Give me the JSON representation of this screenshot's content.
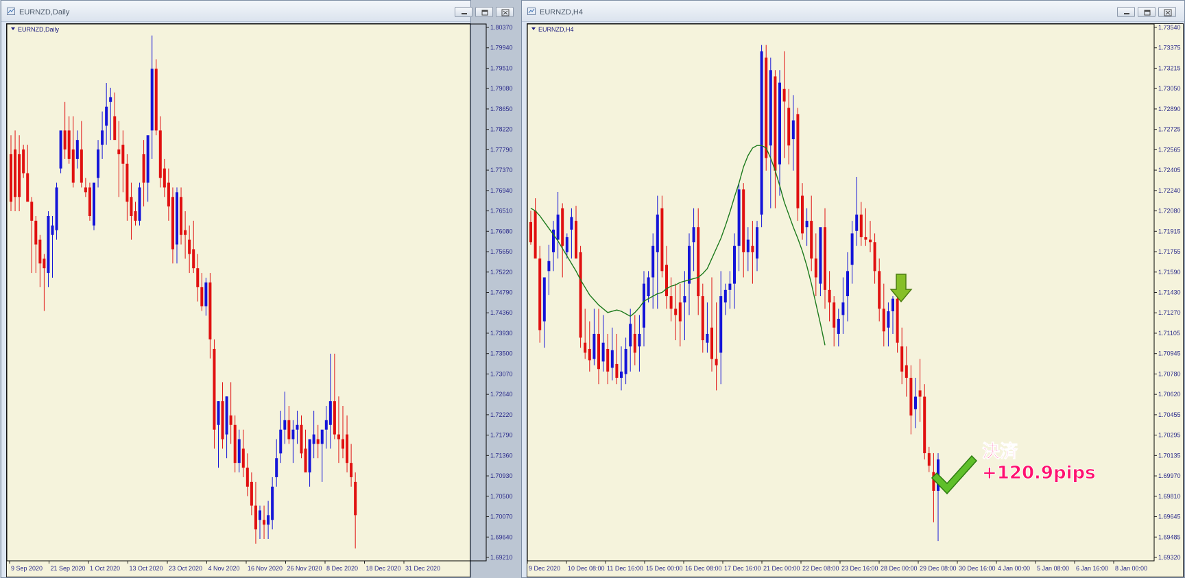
{
  "windows": [
    {
      "title": "EURNZD,Daily",
      "label": "EURNZD,Daily",
      "yTicks": [
        "1.80370",
        "1.79940",
        "1.79510",
        "1.79080",
        "1.78650",
        "1.78220",
        "1.77790",
        "1.77370",
        "1.76940",
        "1.76510",
        "1.76080",
        "1.75650",
        "1.75220",
        "1.74790",
        "1.74360",
        "1.73930",
        "1.73500",
        "1.73070",
        "1.72640",
        "1.72220",
        "1.71790",
        "1.71360",
        "1.70930",
        "1.70500",
        "1.70070",
        "1.69640",
        "1.69210"
      ],
      "xTicks": [
        "9 Sep 2020",
        "21 Sep 2020",
        "1 Oct 2020",
        "13 Oct 2020",
        "23 Oct 2020",
        "4 Nov 2020",
        "16 Nov 2020",
        "26 Nov 2020",
        "8 Dec 2020",
        "18 Dec 2020",
        "31 Dec 2020"
      ]
    },
    {
      "title": "EURNZD,H4",
      "label": "EURNZD,H4",
      "yTicks": [
        "1.73540",
        "1.73375",
        "1.73215",
        "1.73050",
        "1.72890",
        "1.72725",
        "1.72565",
        "1.72405",
        "1.72240",
        "1.72080",
        "1.71915",
        "1.71755",
        "1.71590",
        "1.71430",
        "1.71270",
        "1.71105",
        "1.70945",
        "1.70780",
        "1.70620",
        "1.70455",
        "1.70295",
        "1.70135",
        "1.69970",
        "1.69810",
        "1.69645",
        "1.69485",
        "1.69320"
      ],
      "xTicks": [
        "9 Dec 2020",
        "10 Dec 08:00",
        "11 Dec 16:00",
        "15 Dec 00:00",
        "16 Dec 08:00",
        "17 Dec 16:00",
        "21 Dec 00:00",
        "22 Dec 08:00",
        "23 Dec 16:00",
        "28 Dec 00:00",
        "29 Dec 08:00",
        "30 Dec 16:00",
        "4 Jan 00:00",
        "5 Jan 08:00",
        "6 Jan 16:00",
        "8 Jan 00:00"
      ]
    }
  ],
  "annotation": {
    "line1": "決済",
    "line2": "+120.9pips"
  },
  "colors": {
    "plot_bg": "#f5f3dc",
    "bull": "#1414d8",
    "bear": "#e01010",
    "ma": "#1c7a1c",
    "axis_text": "#2a2a8a",
    "annotation": "#ff1070"
  },
  "chart_data": [
    {
      "type": "candlestick",
      "symbol": "EURNZD",
      "timeframe": "Daily",
      "ylim": [
        1.6921,
        1.8037
      ],
      "candles": [
        [
          1.777,
          1.781,
          1.765,
          1.767
        ],
        [
          1.778,
          1.782,
          1.765,
          1.768
        ],
        [
          1.777,
          1.781,
          1.765,
          1.768
        ],
        [
          1.778,
          1.779,
          1.772,
          1.773
        ],
        [
          1.773,
          1.779,
          1.772,
          1.767
        ],
        [
          1.767,
          1.768,
          1.752,
          1.763
        ],
        [
          1.763,
          1.764,
          1.752,
          1.758
        ],
        [
          1.759,
          1.76,
          1.749,
          1.754
        ],
        [
          1.755,
          1.756,
          1.744,
          1.753
        ],
        [
          1.752,
          1.765,
          1.749,
          1.764
        ],
        [
          1.76,
          1.764,
          1.751,
          1.762
        ],
        [
          1.761,
          1.771,
          1.759,
          1.77
        ],
        [
          1.774,
          1.781,
          1.773,
          1.782
        ],
        [
          1.782,
          1.788,
          1.776,
          1.778
        ],
        [
          1.782,
          1.785,
          1.775,
          1.776
        ],
        [
          1.778,
          1.785,
          1.77,
          1.771
        ],
        [
          1.776,
          1.782,
          1.774,
          1.78
        ],
        [
          1.778,
          1.784,
          1.77,
          1.771
        ],
        [
          1.77,
          1.772,
          1.768,
          1.769
        ],
        [
          1.77,
          1.771,
          1.763,
          1.764
        ],
        [
          1.762,
          1.769,
          1.761,
          1.771
        ],
        [
          1.772,
          1.78,
          1.77,
          1.778
        ],
        [
          1.779,
          1.786,
          1.776,
          1.782
        ],
        [
          1.783,
          1.792,
          1.779,
          1.787
        ],
        [
          1.788,
          1.791,
          1.78,
          1.789
        ],
        [
          1.785,
          1.79,
          1.781,
          1.78
        ],
        [
          1.778,
          1.784,
          1.768,
          1.777
        ],
        [
          1.779,
          1.782,
          1.769,
          1.775
        ],
        [
          1.775,
          1.777,
          1.763,
          1.767
        ],
        [
          1.768,
          1.771,
          1.759,
          1.764
        ],
        [
          1.765,
          1.767,
          1.762,
          1.763
        ],
        [
          1.763,
          1.771,
          1.762,
          1.77
        ],
        [
          1.777,
          1.78,
          1.766,
          1.771
        ],
        [
          1.771,
          1.775,
          1.767,
          1.781
        ],
        [
          1.782,
          1.802,
          1.776,
          1.795
        ],
        [
          1.795,
          1.797,
          1.781,
          1.782
        ],
        [
          1.782,
          1.785,
          1.77,
          1.772
        ],
        [
          1.774,
          1.776,
          1.768,
          1.77
        ],
        [
          1.771,
          1.774,
          1.763,
          1.766
        ],
        [
          1.768,
          1.77,
          1.754,
          1.757
        ],
        [
          1.758,
          1.77,
          1.754,
          1.769
        ],
        [
          1.768,
          1.77,
          1.758,
          1.76
        ],
        [
          1.761,
          1.765,
          1.755,
          1.76
        ],
        [
          1.759,
          1.762,
          1.752,
          1.756
        ],
        [
          1.757,
          1.763,
          1.752,
          1.753
        ],
        [
          1.753,
          1.756,
          1.746,
          1.749
        ],
        [
          1.749,
          1.752,
          1.744,
          1.745
        ],
        [
          1.745,
          1.751,
          1.743,
          1.75
        ],
        [
          1.75,
          1.752,
          1.734,
          1.738
        ],
        [
          1.736,
          1.738,
          1.715,
          1.719
        ],
        [
          1.72,
          1.725,
          1.711,
          1.725
        ],
        [
          1.725,
          1.729,
          1.715,
          1.717
        ],
        [
          1.718,
          1.726,
          1.713,
          1.726
        ],
        [
          1.722,
          1.729,
          1.716,
          1.72
        ],
        [
          1.72,
          1.722,
          1.71,
          1.712
        ],
        [
          1.712,
          1.719,
          1.71,
          1.717
        ],
        [
          1.715,
          1.719,
          1.709,
          1.711
        ],
        [
          1.711,
          1.714,
          1.705,
          1.707
        ],
        [
          1.708,
          1.71,
          1.701,
          1.703
        ],
        [
          1.703,
          1.708,
          1.695,
          1.698
        ],
        [
          1.7,
          1.703,
          1.696,
          1.702
        ],
        [
          1.7,
          1.703,
          1.696,
          1.699
        ],
        [
          1.699,
          1.704,
          1.696,
          1.701
        ],
        [
          1.7,
          1.709,
          1.698,
          1.707
        ],
        [
          1.709,
          1.717,
          1.707,
          1.713
        ],
        [
          1.714,
          1.723,
          1.712,
          1.719
        ],
        [
          1.719,
          1.727,
          1.716,
          1.721
        ],
        [
          1.721,
          1.724,
          1.716,
          1.717
        ],
        [
          1.717,
          1.721,
          1.712,
          1.719
        ],
        [
          1.719,
          1.723,
          1.716,
          1.72
        ],
        [
          1.72,
          1.722,
          1.713,
          1.714
        ],
        [
          1.715,
          1.719,
          1.71,
          1.71
        ],
        [
          1.71,
          1.717,
          1.707,
          1.717
        ],
        [
          1.716,
          1.723,
          1.713,
          1.718
        ],
        [
          1.717,
          1.72,
          1.713,
          1.716
        ],
        [
          1.716,
          1.719,
          1.708,
          1.719
        ],
        [
          1.719,
          1.724,
          1.715,
          1.721
        ],
        [
          1.72,
          1.735,
          1.715,
          1.725
        ],
        [
          1.725,
          1.735,
          1.717,
          1.718
        ],
        [
          1.718,
          1.726,
          1.712,
          1.717
        ],
        [
          1.717,
          1.724,
          1.713,
          1.715
        ],
        [
          1.718,
          1.722,
          1.71,
          1.712
        ],
        [
          1.712,
          1.716,
          1.707,
          1.709
        ],
        [
          1.708,
          1.71,
          1.694,
          1.701
        ]
      ]
    },
    {
      "type": "candlestick",
      "symbol": "EURNZD",
      "timeframe": "H4",
      "ylim": [
        1.6932,
        1.7354
      ],
      "candles": [
        [
          1.7199,
          1.7208,
          1.7181,
          1.7183
        ],
        [
          1.7208,
          1.7218,
          1.718,
          1.717
        ],
        [
          1.717,
          1.718,
          1.7103,
          1.7113
        ],
        [
          1.712,
          1.7138,
          1.7099,
          1.7155
        ],
        [
          1.716,
          1.7181,
          1.7141,
          1.7168
        ],
        [
          1.7175,
          1.72,
          1.716,
          1.7193
        ],
        [
          1.7185,
          1.7223,
          1.717,
          1.7205
        ],
        [
          1.721,
          1.7214,
          1.7155,
          1.718
        ],
        [
          1.7175,
          1.719,
          1.717,
          1.7187
        ],
        [
          1.7193,
          1.721,
          1.717,
          1.7203
        ],
        [
          1.72,
          1.7212,
          1.719,
          1.717
        ],
        [
          1.7175,
          1.718,
          1.7099,
          1.7107
        ],
        [
          1.7103,
          1.713,
          1.709,
          1.7095
        ],
        [
          1.7098,
          1.712,
          1.708,
          1.7089
        ],
        [
          1.709,
          1.713,
          1.7085,
          1.711
        ],
        [
          1.711,
          1.713,
          1.707,
          1.7082
        ],
        [
          1.7088,
          1.7125,
          1.708,
          1.7103
        ],
        [
          1.7098,
          1.711,
          1.707,
          1.708
        ],
        [
          1.7083,
          1.7115,
          1.7073,
          1.7097
        ],
        [
          1.7086,
          1.711,
          1.707,
          1.7075
        ],
        [
          1.7075,
          1.71,
          1.7065,
          1.708
        ],
        [
          1.7078,
          1.7107,
          1.707,
          1.7098
        ],
        [
          1.71,
          1.713,
          1.708,
          1.7118
        ],
        [
          1.711,
          1.7125,
          1.7085,
          1.7095
        ],
        [
          1.71,
          1.7125,
          1.708,
          1.711
        ],
        [
          1.7115,
          1.716,
          1.71,
          1.715
        ],
        [
          1.714,
          1.716,
          1.7135,
          1.7155
        ],
        [
          1.7155,
          1.719,
          1.713,
          1.718
        ],
        [
          1.7175,
          1.722,
          1.713,
          1.7205
        ],
        [
          1.721,
          1.722,
          1.7155,
          1.716
        ],
        [
          1.7165,
          1.718,
          1.713,
          1.714
        ],
        [
          1.714,
          1.7155,
          1.712,
          1.713
        ],
        [
          1.713,
          1.715,
          1.7105,
          1.7125
        ],
        [
          1.7135,
          1.715,
          1.71,
          1.712
        ],
        [
          1.7135,
          1.716,
          1.7105,
          1.714
        ],
        [
          1.715,
          1.719,
          1.7125,
          1.718
        ],
        [
          1.7183,
          1.721,
          1.716,
          1.7195
        ],
        [
          1.7195,
          1.721,
          1.7125,
          1.714
        ],
        [
          1.714,
          1.715,
          1.7095,
          1.7105
        ],
        [
          1.7103,
          1.7135,
          1.7095,
          1.711
        ],
        [
          1.7115,
          1.7155,
          1.708,
          1.709
        ],
        [
          1.709,
          1.7135,
          1.7065,
          1.7085
        ],
        [
          1.7095,
          1.716,
          1.707,
          1.714
        ],
        [
          1.7135,
          1.715,
          1.7125,
          1.7145
        ],
        [
          1.7145,
          1.716,
          1.713,
          1.715
        ],
        [
          1.715,
          1.719,
          1.713,
          1.718
        ],
        [
          1.718,
          1.723,
          1.716,
          1.7225
        ],
        [
          1.7225,
          1.723,
          1.7155,
          1.7175
        ],
        [
          1.7175,
          1.7195,
          1.716,
          1.7185
        ],
        [
          1.718,
          1.72,
          1.715,
          1.7175
        ],
        [
          1.717,
          1.72,
          1.716,
          1.7195
        ],
        [
          1.7205,
          1.734,
          1.7195,
          1.7335
        ],
        [
          1.733,
          1.734,
          1.724,
          1.725
        ],
        [
          1.726,
          1.733,
          1.721,
          1.732
        ],
        [
          1.7315,
          1.732,
          1.721,
          1.724
        ],
        [
          1.7245,
          1.732,
          1.722,
          1.731
        ],
        [
          1.7305,
          1.7335,
          1.725,
          1.7295
        ],
        [
          1.729,
          1.7305,
          1.7245,
          1.726
        ],
        [
          1.7265,
          1.73,
          1.724,
          1.728
        ],
        [
          1.7285,
          1.729,
          1.72,
          1.721
        ],
        [
          1.722,
          1.723,
          1.7185,
          1.719
        ],
        [
          1.7195,
          1.721,
          1.718,
          1.72
        ],
        [
          1.72,
          1.722,
          1.716,
          1.717
        ],
        [
          1.717,
          1.719,
          1.714,
          1.7155
        ],
        [
          1.715,
          1.718,
          1.714,
          1.7195
        ],
        [
          1.7195,
          1.721,
          1.713,
          1.7145
        ],
        [
          1.7145,
          1.716,
          1.712,
          1.7135
        ],
        [
          1.7135,
          1.714,
          1.71,
          1.7115
        ],
        [
          1.711,
          1.713,
          1.71,
          1.7122
        ],
        [
          1.7125,
          1.7155,
          1.711,
          1.7135
        ],
        [
          1.714,
          1.7175,
          1.712,
          1.716
        ],
        [
          1.7165,
          1.72,
          1.715,
          1.719
        ],
        [
          1.7192,
          1.7235,
          1.718,
          1.7205
        ],
        [
          1.7205,
          1.7215,
          1.718,
          1.7187
        ],
        [
          1.7187,
          1.721,
          1.718,
          1.7185
        ],
        [
          1.7185,
          1.72,
          1.7175,
          1.7183
        ],
        [
          1.7183,
          1.719,
          1.715,
          1.716
        ],
        [
          1.716,
          1.717,
          1.712,
          1.713
        ],
        [
          1.713,
          1.715,
          1.71,
          1.7112
        ],
        [
          1.7115,
          1.7135,
          1.71,
          1.7128
        ],
        [
          1.7128,
          1.714,
          1.711,
          1.7138
        ],
        [
          1.7138,
          1.7145,
          1.7095,
          1.7103
        ],
        [
          1.71,
          1.7115,
          1.707,
          1.708
        ],
        [
          1.7085,
          1.71,
          1.706,
          1.7075
        ],
        [
          1.7075,
          1.7085,
          1.703,
          1.7045
        ],
        [
          1.705,
          1.7075,
          1.7035,
          1.706
        ],
        [
          1.7065,
          1.709,
          1.704,
          1.706
        ],
        [
          1.706,
          1.707,
          1.701,
          1.7015
        ],
        [
          1.7015,
          1.702,
          1.7,
          1.7005
        ],
        [
          1.7,
          1.7015,
          1.696,
          1.6985
        ],
        [
          1.6985,
          1.7015,
          1.6945,
          1.701
        ]
      ],
      "ma": [
        1.721,
        1.7208,
        1.7204,
        1.7199,
        1.7194,
        1.7189,
        1.7184,
        1.7178,
        1.7172,
        1.7166,
        1.716,
        1.7153,
        1.7147,
        1.7141,
        1.7137,
        1.7133,
        1.713,
        1.7127,
        1.7128,
        1.7129,
        1.7128,
        1.7126,
        1.7124,
        1.7127,
        1.7131,
        1.7136,
        1.7138,
        1.714,
        1.7142,
        1.7143,
        1.7146,
        1.7148,
        1.7149,
        1.7151,
        1.7152,
        1.7153,
        1.7154,
        1.7155,
        1.7158,
        1.7162,
        1.717,
        1.7178,
        1.7186,
        1.7196,
        1.7207,
        1.7219,
        1.723,
        1.7243,
        1.7252,
        1.7258,
        1.726,
        1.726,
        1.7258,
        1.725,
        1.724,
        1.7228,
        1.7215,
        1.7205,
        1.7195,
        1.7186,
        1.7176,
        1.7164,
        1.715,
        1.7134,
        1.7118,
        1.7101
      ],
      "arrow_signal": "sell",
      "exit_annotation": "決済 +120.9pips"
    }
  ]
}
